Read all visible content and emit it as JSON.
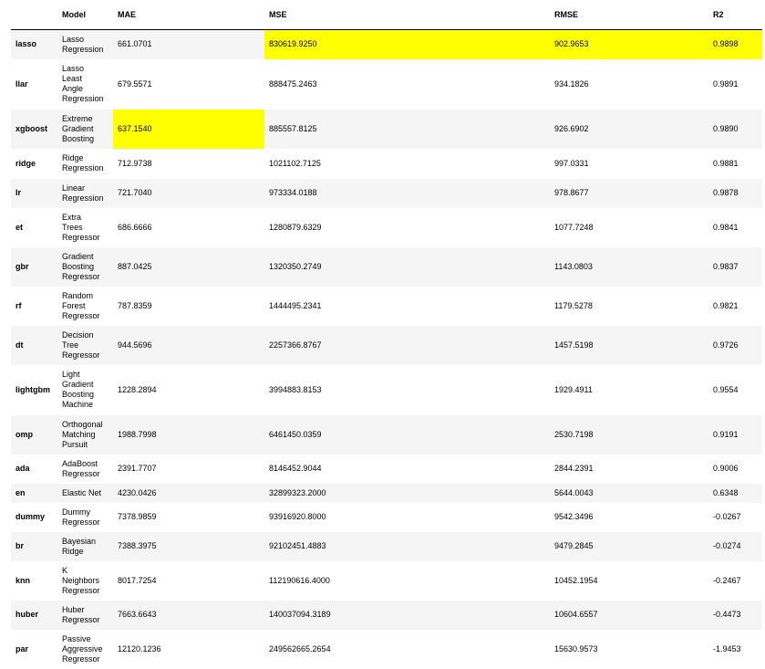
{
  "table": {
    "headers": [
      "",
      "Model",
      "MAE",
      "MSE",
      "RMSE",
      "R2"
    ],
    "rows": [
      {
        "id": "lasso",
        "model": "Lasso Regression",
        "mae": "661.0701",
        "mse": "830619.9250",
        "rmse": "902.9653",
        "r2": "0.9898"
      },
      {
        "id": "llar",
        "model": "Lasso Least Angle Regression",
        "mae": "679.5571",
        "mse": "888475.2463",
        "rmse": "934.1826",
        "r2": "0.9891"
      },
      {
        "id": "xgboost",
        "model": "Extreme Gradient Boosting",
        "mae": "637.1540",
        "mse": "885557.8125",
        "rmse": "926.6902",
        "r2": "0.9890"
      },
      {
        "id": "ridge",
        "model": "Ridge Regression",
        "mae": "712.9738",
        "mse": "1021102.7125",
        "rmse": "997.0331",
        "r2": "0.9881"
      },
      {
        "id": "lr",
        "model": "Linear Regression",
        "mae": "721.7040",
        "mse": "973334.0188",
        "rmse": "978.8677",
        "r2": "0.9878"
      },
      {
        "id": "et",
        "model": "Extra Trees Regressor",
        "mae": "686.6666",
        "mse": "1280879.6329",
        "rmse": "1077.7248",
        "r2": "0.9841"
      },
      {
        "id": "gbr",
        "model": "Gradient Boosting Regressor",
        "mae": "887.0425",
        "mse": "1320350.2749",
        "rmse": "1143.0803",
        "r2": "0.9837"
      },
      {
        "id": "rf",
        "model": "Random Forest Regressor",
        "mae": "787.8359",
        "mse": "1444495.2341",
        "rmse": "1179.5278",
        "r2": "0.9821"
      },
      {
        "id": "dt",
        "model": "Decision Tree Regressor",
        "mae": "944.5696",
        "mse": "2257366.8767",
        "rmse": "1457.5198",
        "r2": "0.9726"
      },
      {
        "id": "lightgbm",
        "model": "Light Gradient Boosting Machine",
        "mae": "1228.2894",
        "mse": "3994883.8153",
        "rmse": "1929.4911",
        "r2": "0.9554"
      },
      {
        "id": "omp",
        "model": "Orthogonal Matching Pursuit",
        "mae": "1988.7998",
        "mse": "6461450.0359",
        "rmse": "2530.7198",
        "r2": "0.9191"
      },
      {
        "id": "ada",
        "model": "AdaBoost Regressor",
        "mae": "2391.7707",
        "mse": "8146452.9044",
        "rmse": "2844.2391",
        "r2": "0.9006"
      },
      {
        "id": "en",
        "model": "Elastic Net",
        "mae": "4230.0426",
        "mse": "32899323.2000",
        "rmse": "5644.0043",
        "r2": "0.6348"
      },
      {
        "id": "dummy",
        "model": "Dummy Regressor",
        "mae": "7378.9859",
        "mse": "93916920.8000",
        "rmse": "9542.3496",
        "r2": "-0.0267"
      },
      {
        "id": "br",
        "model": "Bayesian Ridge",
        "mae": "7388.3975",
        "mse": "92102451.4883",
        "rmse": "9479.2845",
        "r2": "-0.0274"
      },
      {
        "id": "knn",
        "model": "K Neighbors Regressor",
        "mae": "8017.7254",
        "mse": "112190616.4000",
        "rmse": "10452.1954",
        "r2": "-0.2467"
      },
      {
        "id": "huber",
        "model": "Huber Regressor",
        "mae": "7663.6643",
        "mse": "140037094.3189",
        "rmse": "10604.6557",
        "r2": "-0.4473"
      },
      {
        "id": "par",
        "model": "Passive Aggressive Regressor",
        "mae": "12120.1236",
        "mse": "249562665.2654",
        "rmse": "15630.9573",
        "r2": "-1.9453"
      }
    ],
    "highlight_color": "#ffff00"
  }
}
